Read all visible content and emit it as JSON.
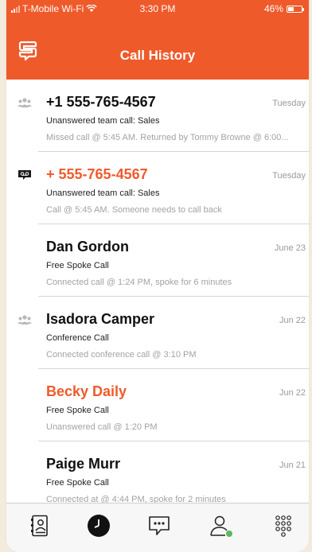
{
  "status_bar": {
    "carrier": "T-Mobile Wi-Fi",
    "time": "3:30 PM",
    "battery": "46%",
    "battery_level": 0.46
  },
  "header": {
    "title": "Call History",
    "logo_icon": "spoke-logo-icon"
  },
  "calls": [
    {
      "name": "+1 555-765-4567",
      "type": "Unanswered team call: Sales",
      "detail": "Missed call @ 5:45 AM. Returned by Tommy Browne @ 6:00...",
      "date": "Tuesday",
      "icon": "team-icon",
      "missed": false
    },
    {
      "name": "+ 555-765-4567",
      "type": "Unanswered team call: Sales",
      "detail": "Call @ 5:45 AM. Someone needs to call back",
      "date": "Tuesday",
      "icon": "voicemail-icon",
      "missed": true
    },
    {
      "name": "Dan Gordon",
      "type": "Free Spoke Call",
      "detail": "Connected call @ 1:24 PM, spoke for 6 minutes",
      "date": "June 23",
      "icon": "",
      "missed": false
    },
    {
      "name": "Isadora Camper",
      "type": "Conference Call",
      "detail": "Connected conference call @ 3:10 PM",
      "date": "Jun 22",
      "icon": "team-icon",
      "missed": false
    },
    {
      "name": "Becky Daily",
      "type": "Free Spoke Call",
      "detail": "Unanswered call @ 1:20 PM",
      "date": "Jun 22",
      "icon": "",
      "missed": true
    },
    {
      "name": "Paige Murr",
      "type": "Free Spoke Call",
      "detail": "Connected at @ 4:44 PM, spoke for 2 minutes",
      "date": "Jun 21",
      "icon": "",
      "missed": false
    }
  ],
  "tabs": [
    {
      "icon": "contacts-icon",
      "active": false
    },
    {
      "icon": "call-history-icon",
      "active": true
    },
    {
      "icon": "messages-icon",
      "active": false
    },
    {
      "icon": "profile-status-icon",
      "active": false
    },
    {
      "icon": "dialpad-icon",
      "active": false
    }
  ],
  "colors": {
    "accent": "#ef5a2b",
    "status_online": "#5cb85c",
    "text_secondary": "#a3a3a3"
  }
}
